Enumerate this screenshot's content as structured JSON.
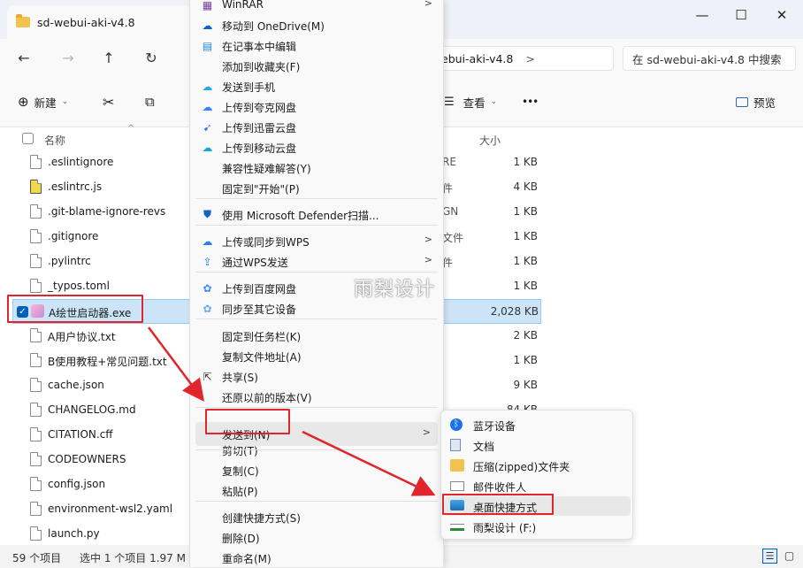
{
  "window": {
    "tab_title": "sd-webui-aki-v4.8",
    "minimize": "—",
    "maximize": "☐",
    "close": "✕"
  },
  "nav": {
    "address_tail": "ebui-aki-v4.8",
    "address_chevron": ">",
    "search_placeholder": "在 sd-webui-aki-v4.8 中搜索"
  },
  "toolbar": {
    "new_label": "新建",
    "view_label": "查看",
    "preview_label": "预览",
    "more": "•••"
  },
  "columns": {
    "name": "名称",
    "size": "大小"
  },
  "files": [
    {
      "name": ".eslintignore",
      "type": "RE",
      "size": "1 KB"
    },
    {
      "name": ".eslintrc.js",
      "type": "件",
      "size": "4 KB"
    },
    {
      "name": ".git-blame-ignore-revs",
      "type": "GN",
      "size": "1 KB"
    },
    {
      "name": ".gitignore",
      "type": "文件",
      "size": "1 KB"
    },
    {
      "name": ".pylintrc",
      "type": "件",
      "size": "1 KB"
    },
    {
      "name": "_typos.toml",
      "type": "",
      "size": "1 KB"
    },
    {
      "name": "A绘世启动器.exe",
      "type": "",
      "size": "2,028 KB"
    },
    {
      "name": "A用户协议.txt",
      "type": "",
      "size": "2 KB"
    },
    {
      "name": "B使用教程+常见问题.txt",
      "type": "",
      "size": "1 KB"
    },
    {
      "name": "cache.json",
      "type": "",
      "size": "9 KB"
    },
    {
      "name": "CHANGELOG.md",
      "type": "",
      "size": "84 KB"
    },
    {
      "name": "CITATION.cff",
      "type": "",
      "size": ""
    },
    {
      "name": "CODEOWNERS",
      "type": "",
      "size": ""
    },
    {
      "name": "config.json",
      "type": "",
      "size": ""
    },
    {
      "name": "environment-wsl2.yaml",
      "type": "",
      "size": ""
    },
    {
      "name": "launch.py",
      "type": "",
      "size": ""
    }
  ],
  "status": {
    "count": "59 个项目",
    "selected": "选中 1 个项目  1.97 M"
  },
  "context_menu": [
    {
      "label": "WinRAR",
      "icon": "winrar-icon",
      "arrow": ">"
    },
    {
      "label": "移动到 OneDrive(M)",
      "icon": "onedrive-icon"
    },
    {
      "label": "在记事本中编辑",
      "icon": "notepad-icon"
    },
    {
      "label": "添加到收藏夹(F)",
      "icon": ""
    },
    {
      "label": "发送到手机",
      "icon": "phone-cloud-icon"
    },
    {
      "label": "上传到夸克网盘",
      "icon": "quark-icon"
    },
    {
      "label": "上传到迅雷云盘",
      "icon": "xunlei-icon"
    },
    {
      "label": "上传到移动云盘",
      "icon": "mobile-cloud-icon"
    },
    {
      "label": "兼容性疑难解答(Y)",
      "icon": ""
    },
    {
      "label": "固定到\"开始\"(P)",
      "icon": ""
    },
    {
      "label": "使用 Microsoft Defender扫描...",
      "icon": "defender-icon"
    },
    {
      "label": "上传或同步到WPS",
      "icon": "wps-cloud-icon",
      "arrow": ">"
    },
    {
      "label": "通过WPS发送",
      "icon": "wps-send-icon",
      "arrow": ">"
    },
    {
      "label": "上传到百度网盘",
      "icon": "baidu-icon"
    },
    {
      "label": "同步至其它设备",
      "icon": "sync-icon"
    },
    {
      "label": "固定到任务栏(K)",
      "icon": ""
    },
    {
      "label": "复制文件地址(A)",
      "icon": ""
    },
    {
      "label": "共享(S)",
      "icon": "share-icon"
    },
    {
      "label": "还原以前的版本(V)",
      "icon": ""
    },
    {
      "label": "发送到(N)",
      "icon": "",
      "arrow": ">"
    },
    {
      "label": "剪切(T)",
      "icon": ""
    },
    {
      "label": "复制(C)",
      "icon": ""
    },
    {
      "label": "粘贴(P)",
      "icon": ""
    },
    {
      "label": "创建快捷方式(S)",
      "icon": ""
    },
    {
      "label": "删除(D)",
      "icon": ""
    },
    {
      "label": "重命名(M)",
      "icon": ""
    }
  ],
  "sendto_menu": [
    {
      "label": "蓝牙设备",
      "icon": "bluetooth-icon"
    },
    {
      "label": "文档",
      "icon": "document-icon"
    },
    {
      "label": "压缩(zipped)文件夹",
      "icon": "zip-folder-icon"
    },
    {
      "label": "邮件收件人",
      "icon": "mail-icon"
    },
    {
      "label": "桌面快捷方式",
      "icon": "desktop-icon"
    },
    {
      "label": "雨梨设计 (F:)",
      "icon": "drive-icon"
    }
  ],
  "watermark": "雨梨设计",
  "colors": {
    "accent": "#005fb8",
    "annotation_red": "#e0262c",
    "selection": "#cce4f7"
  }
}
